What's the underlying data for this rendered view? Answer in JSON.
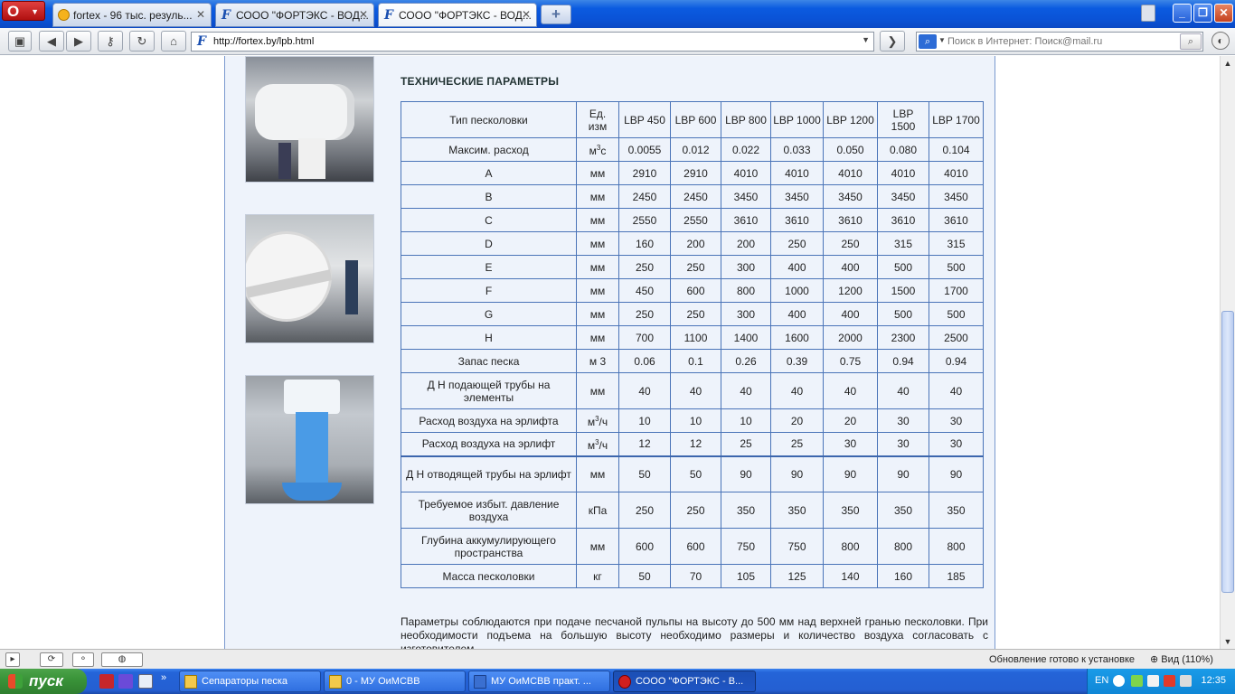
{
  "browser": {
    "opera_button": "O",
    "tabs": [
      {
        "label": "fortex - 96 тыс. резуль...",
        "close": "✕"
      },
      {
        "label": "СООО \"ФОРТЭКС - ВОД...",
        "close": "✕"
      },
      {
        "label": "СООО \"ФОРТЭКС - ВОД...",
        "close": "✕"
      }
    ],
    "new_tab": "+",
    "url": "http://fortex.by/lpb.html",
    "search_placeholder": "Поиск в Интернет: Поиск@mail.ru",
    "window_buttons": {
      "minimize": "_",
      "restore": "❐",
      "close": "✕"
    }
  },
  "page": {
    "section_title": "ТЕХНИЧЕСКИЕ ПАРАМЕТРЫ",
    "table": {
      "header": {
        "param": "Тип песколовки",
        "unit": "Ед. изм",
        "models": [
          "LBP 450",
          "LBP 600",
          "LBP 800",
          "LBP 1000",
          "LBP 1200",
          "LBP 1500",
          "LBP 1700"
        ]
      },
      "rows": [
        {
          "param": "Максим. расход",
          "unit_base": "м",
          "unit_sup": "3",
          "unit_tail": "с",
          "values": [
            "0.0055",
            "0.012",
            "0.022",
            "0.033",
            "0.050",
            "0.080",
            "0.104"
          ]
        },
        {
          "param": "A",
          "unit": "мм",
          "values": [
            "2910",
            "2910",
            "4010",
            "4010",
            "4010",
            "4010",
            "4010"
          ]
        },
        {
          "param": "B",
          "unit": "мм",
          "values": [
            "2450",
            "2450",
            "3450",
            "3450",
            "3450",
            "3450",
            "3450"
          ]
        },
        {
          "param": "C",
          "unit": "мм",
          "values": [
            "2550",
            "2550",
            "3610",
            "3610",
            "3610",
            "3610",
            "3610"
          ]
        },
        {
          "param": "D",
          "unit": "мм",
          "values": [
            "160",
            "200",
            "200",
            "250",
            "250",
            "315",
            "315"
          ]
        },
        {
          "param": "E",
          "unit": "мм",
          "values": [
            "250",
            "250",
            "300",
            "400",
            "400",
            "500",
            "500"
          ]
        },
        {
          "param": "F",
          "unit": "мм",
          "values": [
            "450",
            "600",
            "800",
            "1000",
            "1200",
            "1500",
            "1700"
          ]
        },
        {
          "param": "G",
          "unit": "мм",
          "values": [
            "250",
            "250",
            "300",
            "400",
            "400",
            "500",
            "500"
          ]
        },
        {
          "param": "H",
          "unit": "мм",
          "values": [
            "700",
            "1100",
            "1400",
            "1600",
            "2000",
            "2300",
            "2500"
          ]
        },
        {
          "param": "Запас песка",
          "unit": "м 3",
          "values": [
            "0.06",
            "0.1",
            "0.26",
            "0.39",
            "0.75",
            "0.94",
            "0.94"
          ]
        },
        {
          "param": "Д Н подающей трубы на элементы",
          "unit": "мм",
          "values": [
            "40",
            "40",
            "40",
            "40",
            "40",
            "40",
            "40"
          ],
          "tall": true
        },
        {
          "param": "Расход воздуха на эрлифта",
          "unit_base": "м",
          "unit_sup": "3",
          "unit_tail": "/ч",
          "values": [
            "10",
            "10",
            "10",
            "20",
            "20",
            "30",
            "30"
          ]
        },
        {
          "param": "Расход воздуха на эрлифт",
          "unit_base": "м",
          "unit_sup": "3",
          "unit_tail": "/ч",
          "values": [
            "12",
            "12",
            "25",
            "25",
            "30",
            "30",
            "30"
          ]
        },
        {
          "param": "Д Н отводящей трубы на эрлифт",
          "unit": "мм",
          "values": [
            "50",
            "50",
            "90",
            "90",
            "90",
            "90",
            "90"
          ],
          "tall": true,
          "thick": true
        },
        {
          "param": "Требуемое избыт. давление воздуха",
          "unit": "кПа",
          "values": [
            "250",
            "250",
            "350",
            "350",
            "350",
            "350",
            "350"
          ],
          "tall": true
        },
        {
          "param": "Глубина аккумулирующего пространства",
          "unit": "мм",
          "values": [
            "600",
            "600",
            "750",
            "750",
            "800",
            "800",
            "800"
          ],
          "tall": true
        },
        {
          "param": "Масса песколовки",
          "unit": "кг",
          "values": [
            "50",
            "70",
            "105",
            "125",
            "140",
            "160",
            "185"
          ]
        }
      ]
    },
    "footnote": "Параметры соблюдаются при подаче песчаной пульпы на высоту до 500 мм над верхней гранью песколовки. При необходимости подъема на большую высоту необходимо размеры и количество воздуха согласовать с изготовителем."
  },
  "statusbar": {
    "update_text": "Обновление готово к установке",
    "zoom_text": "Вид (110%)"
  },
  "taskbar": {
    "start_label": "пуск",
    "tasks": [
      {
        "label": "Сепараторы песка"
      },
      {
        "label": "0 - МУ ОиМСВВ"
      },
      {
        "label": "МУ ОиМСВВ практ. ..."
      },
      {
        "label": "СООО \"ФОРТЭКС - В..."
      }
    ],
    "lang": "EN",
    "clock": "12:35"
  },
  "colors": {
    "content_bg": "#eef3fb",
    "table_border": "#4a74b8",
    "titlebar_blue": "#0a52d6",
    "start_green": "#3a9439"
  }
}
